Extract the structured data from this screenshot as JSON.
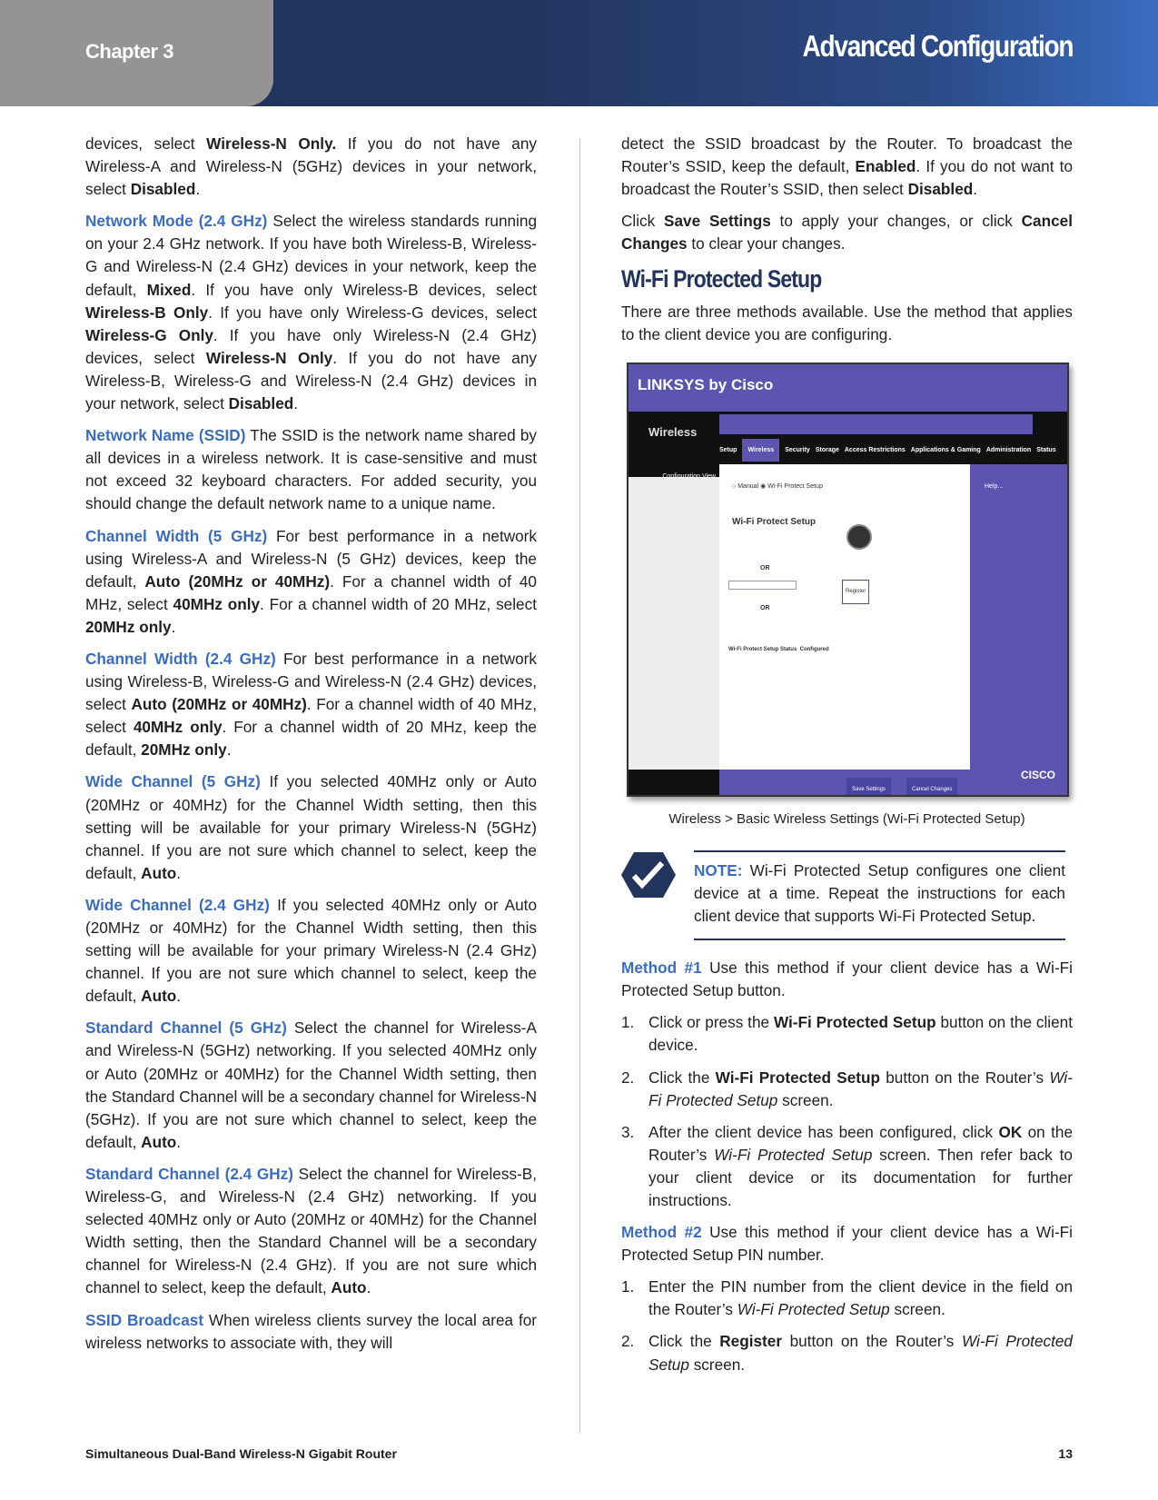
{
  "header": {
    "chapter": "Chapter 3",
    "title": "Advanced Configuration"
  },
  "left": [
    [
      {
        "t": "devices, select "
      },
      {
        "t": "Wireless-N Only.",
        "s": "b"
      },
      {
        "t": " If you do not have any Wireless-A and Wireless-N (5GHz) devices in your network, select "
      },
      {
        "t": "Disabled",
        "s": "b"
      },
      {
        "t": "."
      }
    ],
    [
      {
        "t": "Network Mode (2.4 GHz)",
        "s": "l"
      },
      {
        "t": "  Select the wireless standards running on your 2.4 GHz network. If you have both Wireless-B, Wireless-G and Wireless-N (2.4 GHz) devices in your network, keep the default, "
      },
      {
        "t": "Mixed",
        "s": "b"
      },
      {
        "t": ". If you have only Wireless-B devices, select "
      },
      {
        "t": "Wireless-B Only",
        "s": "b"
      },
      {
        "t": ". If you have only Wireless-G devices, select "
      },
      {
        "t": "Wireless-G Only",
        "s": "b"
      },
      {
        "t": ". If you have only Wireless-N (2.4 GHz) devices, select "
      },
      {
        "t": "Wireless-N Only",
        "s": "b"
      },
      {
        "t": ". If you do not have any Wireless-B, Wireless-G and Wireless-N (2.4 GHz) devices in your network, select "
      },
      {
        "t": "Disabled",
        "s": "b"
      },
      {
        "t": "."
      }
    ],
    [
      {
        "t": "Network Name (SSID)",
        "s": "l"
      },
      {
        "t": " The SSID is the network name shared by all devices in a wireless network. It is case-sensitive and must not exceed 32 keyboard characters. For added security, you should change the default network name to a unique name."
      }
    ],
    [
      {
        "t": "Channel Width (5 GHz)",
        "s": "l"
      },
      {
        "t": " For best performance in a network using Wireless-A and Wireless-N (5 GHz) devices, keep the default, "
      },
      {
        "t": "Auto (20MHz or 40MHz)",
        "s": "b"
      },
      {
        "t": ". For a channel width of 40 MHz, select "
      },
      {
        "t": "40MHz only",
        "s": "b"
      },
      {
        "t": ". For a channel width of 20 MHz, select "
      },
      {
        "t": "20MHz only",
        "s": "b"
      },
      {
        "t": "."
      }
    ],
    [
      {
        "t": "Channel Width (2.4 GHz)",
        "s": "l"
      },
      {
        "t": " For best performance in a network using Wireless-B, Wireless-G and Wireless-N (2.4 GHz) devices, select "
      },
      {
        "t": "Auto (20MHz or 40MHz)",
        "s": "b"
      },
      {
        "t": ". For a channel width of 40 MHz, select "
      },
      {
        "t": "40MHz only",
        "s": "b"
      },
      {
        "t": ". For a channel width of 20 MHz, keep the default, "
      },
      {
        "t": "20MHz only",
        "s": "b"
      },
      {
        "t": "."
      }
    ],
    [
      {
        "t": "Wide Channel (5 GHz)",
        "s": "l"
      },
      {
        "t": "  If you selected 40MHz only or Auto (20MHz or 40MHz) for the Channel Width setting, then this setting will be available for your primary Wireless-N (5GHz) channel. If you are not sure which channel to select, keep the default, "
      },
      {
        "t": "Auto",
        "s": "b"
      },
      {
        "t": "."
      }
    ],
    [
      {
        "t": "Wide Channel (2.4 GHz)",
        "s": "l"
      },
      {
        "t": "  If you selected 40MHz only or Auto (20MHz or 40MHz) for the Channel Width setting, then this setting will be available for your primary Wireless-N (2.4 GHz) channel. If you are not sure which channel to select, keep the default, "
      },
      {
        "t": "Auto",
        "s": "b"
      },
      {
        "t": "."
      }
    ],
    [
      {
        "t": "Standard Channel (5 GHz)",
        "s": "l"
      },
      {
        "t": " Select the channel for Wireless-A and Wireless-N (5GHz) networking. If you selected 40MHz only or Auto (20MHz or 40MHz) for the Channel Width setting, then the Standard Channel will be a secondary channel for Wireless-N (5GHz). If you are not sure which channel to select, keep the default, "
      },
      {
        "t": "Auto",
        "s": "b"
      },
      {
        "t": "."
      }
    ],
    [
      {
        "t": "Standard Channel (2.4 GHz)",
        "s": "l"
      },
      {
        "t": " Select the channel for Wireless-B, Wireless-G, and Wireless-N (2.4 GHz) networking. If you selected 40MHz only or Auto (20MHz or 40MHz) for the Channel Width setting, then the Standard Channel will be a secondary channel for Wireless-N (2.4 GHz). If you are not sure which channel to select, keep the default, "
      },
      {
        "t": "Auto",
        "s": "b"
      },
      {
        "t": "."
      }
    ],
    [
      {
        "t": "SSID Broadcast",
        "s": "l"
      },
      {
        "t": "  When wireless clients survey the local area for wireless networks to associate with, they will"
      }
    ]
  ],
  "right_top": [
    [
      {
        "t": "detect the SSID broadcast by the Router. To broadcast the Router’s SSID, keep the default, "
      },
      {
        "t": "Enabled",
        "s": "b"
      },
      {
        "t": ". If you do not want to broadcast the Router’s SSID, then select "
      },
      {
        "t": "Disabled",
        "s": "b"
      },
      {
        "t": "."
      }
    ],
    [
      {
        "t": "Click "
      },
      {
        "t": "Save Settings",
        "s": "b"
      },
      {
        "t": " to apply your changes, or click "
      },
      {
        "t": "Cancel Changes",
        "s": "b"
      },
      {
        "t": " to clear your changes."
      }
    ]
  ],
  "section_heading": "Wi-Fi Protected Setup",
  "intro": [
    [
      {
        "t": "There are three methods available. Use the method that applies to the client device you are configuring."
      }
    ]
  ],
  "screenshot": {
    "logo": "LINKSYS by Cisco",
    "section": "Wireless",
    "tabs": [
      "Setup",
      "Wireless",
      "Security",
      "Storage",
      "Access Restrictions",
      "Applications & Gaming",
      "Administration",
      "Status"
    ],
    "config_view": "Configuration View",
    "radio_manual": "Manual",
    "radio_wps": "Wi-Fi Protect Setup",
    "heading": "Wi-Fi Protect Setup",
    "or": "OR",
    "register": "Register",
    "status_label": "Wi-Fi Protect Setup Status",
    "status_value": "Configured",
    "help": "Help...",
    "save": "Save Settings",
    "cancel": "Cancel Changes",
    "brand": "cisco"
  },
  "caption": "Wireless > Basic Wireless Settings (Wi-Fi Protected Setup)",
  "note": [
    [
      {
        "t": "NOTE:",
        "s": "l"
      },
      {
        "t": " Wi-Fi Protected Setup configures one client device at a time. Repeat the instructions for each client device that supports Wi-Fi Protected Setup."
      }
    ]
  ],
  "method1": [
    [
      {
        "t": "Method #1",
        "s": "l"
      },
      {
        "t": "  Use this method if your client device has a Wi-Fi Protected Setup button."
      }
    ]
  ],
  "method1_steps": [
    [
      {
        "t": "Click or press the "
      },
      {
        "t": "Wi-Fi Protected Setup",
        "s": "b"
      },
      {
        "t": " button on the client device."
      }
    ],
    [
      {
        "t": "Click the "
      },
      {
        "t": "Wi-Fi Protected Setup",
        "s": "b"
      },
      {
        "t": " button on the Router’s "
      },
      {
        "t": "Wi-Fi Protected Setup",
        "s": "i"
      },
      {
        "t": " screen."
      }
    ],
    [
      {
        "t": "After the client device has been configured, click "
      },
      {
        "t": "OK",
        "s": "b"
      },
      {
        "t": " on the Router’s "
      },
      {
        "t": "Wi-Fi Protected Setup",
        "s": "i"
      },
      {
        "t": " screen. Then refer back to your client device or its documentation for further instructions."
      }
    ]
  ],
  "method2": [
    [
      {
        "t": "Method #2",
        "s": "l"
      },
      {
        "t": "  Use this method if your client device has a Wi-Fi Protected Setup PIN number."
      }
    ]
  ],
  "method2_steps": [
    [
      {
        "t": "Enter the PIN number from the client device in the field on the Router’s "
      },
      {
        "t": "Wi-Fi Protected Setup",
        "s": "i"
      },
      {
        "t": " screen."
      }
    ],
    [
      {
        "t": "Click the "
      },
      {
        "t": "Register",
        "s": "b"
      },
      {
        "t": " button on the Router’s "
      },
      {
        "t": "Wi-Fi Protected Setup",
        "s": "i"
      },
      {
        "t": " screen."
      }
    ]
  ],
  "footer": {
    "product": "Simultaneous Dual-Band Wireless-N Gigabit Router",
    "page": "13"
  },
  "colors": {
    "accent": "#3a6cc0",
    "header_dark": "#22335c",
    "tab_gray": "#959393",
    "router_purple": "#5d54b0"
  }
}
